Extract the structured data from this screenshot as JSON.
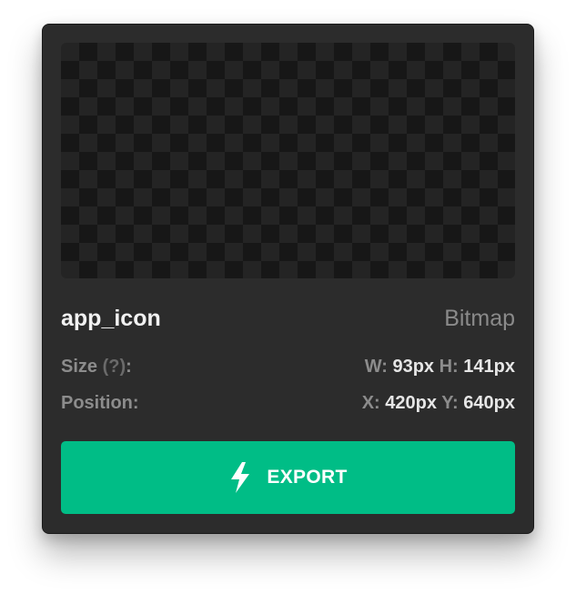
{
  "asset": {
    "name": "app_icon",
    "type": "Bitmap"
  },
  "size": {
    "label": "Size",
    "help": "(?)",
    "colon": ":",
    "w_key": "W:",
    "w_value": "93px",
    "h_key": "H:",
    "h_value": "141px"
  },
  "position": {
    "label": "Position:",
    "x_key": "X:",
    "x_value": "420px",
    "y_key": "Y:",
    "y_value": "640px"
  },
  "export_button": {
    "label": "EXPORT",
    "icon": "lightning-bolt-icon"
  },
  "colors": {
    "card_background": "#2c2c2c",
    "accent": "#00bd86",
    "checker_dark": "#171717",
    "checker_light": "#242424"
  }
}
